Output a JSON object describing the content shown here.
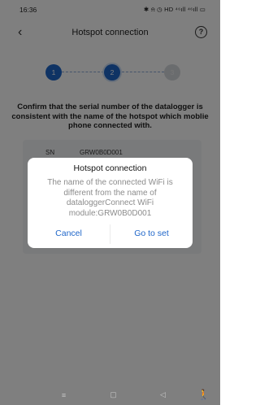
{
  "status_bar": {
    "time": "16:36",
    "icons_text": "✱ ⍾ ◷ HD ⁴⁶ıll ⁴⁶ıll ▭"
  },
  "nav": {
    "title": "Hotspot connection",
    "back_icon": "chevron-left-icon",
    "help_icon": "question-circle-icon",
    "help_glyph": "?"
  },
  "steps": [
    {
      "number": "1",
      "state": "done"
    },
    {
      "number": "2",
      "state": "active"
    },
    {
      "number": "3",
      "state": "todo"
    }
  ],
  "content": {
    "confirm_text": "Confirm that the serial number of the datalogger is consistent with the name of the hotspot which moblie phone connected with.",
    "sn_label": "SN",
    "sn_value": "GRW0B0D001"
  },
  "dialog": {
    "title": "Hotspot connection",
    "message": "The name of the connected WiFi is different from the name of dataloggerConnect WiFi module:GRW0B0D001",
    "cancel_label": "Cancel",
    "confirm_label": "Go to set"
  },
  "system_nav": {
    "menu_glyph": "≡",
    "home_glyph": "▢",
    "back_glyph": "◁",
    "accessibility_glyph": "🚶"
  },
  "colors": {
    "accent": "#1f66c9",
    "overlay": "rgba(0,0,0,0.5)",
    "step_inactive": "#d5d8dc"
  }
}
